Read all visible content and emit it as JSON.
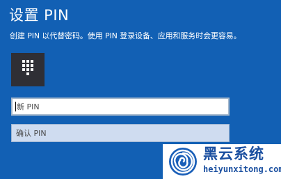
{
  "header": {
    "title": "设置 PIN",
    "subtitle": "创建 PIN 以代替密码。使用 PIN 登录设备、应用和服务时会更容易。"
  },
  "keypad": {
    "icon": "numeric-keypad-icon"
  },
  "form": {
    "new_pin_placeholder": "新 PIN",
    "confirm_pin_placeholder": "确认 PIN"
  },
  "watermark": {
    "brand": "黑云系统",
    "url": "heiyunxitong.com",
    "icon": "spiral-logo-icon"
  },
  "colors": {
    "background": "#1260b4",
    "text": "#ffffff",
    "keypad_tile": "#2f2f35",
    "confirm_field": "#cfdcf0",
    "watermark_text": "#1a4fa0"
  }
}
